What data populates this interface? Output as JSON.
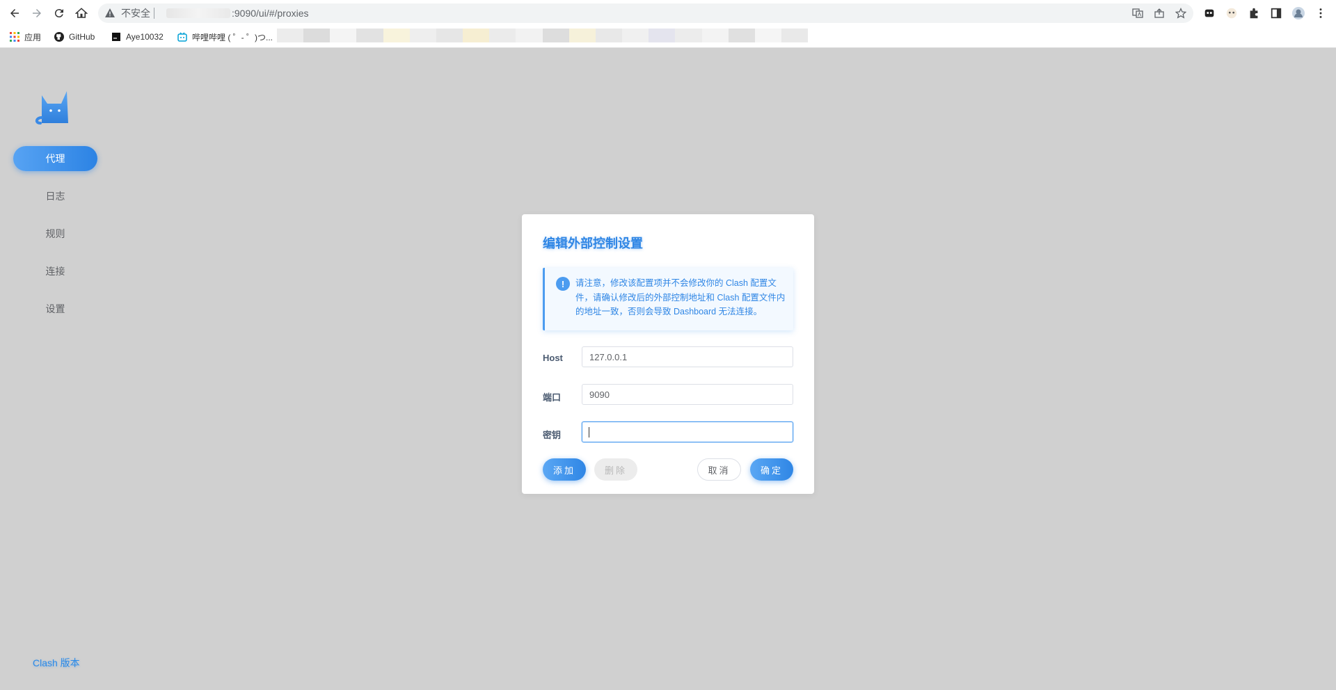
{
  "browser": {
    "security_label": "不安全",
    "url": ":9090/ui/#/proxies",
    "bookmarks": [
      {
        "label": "应用",
        "icon": "apps-grid-icon"
      },
      {
        "label": "GitHub",
        "icon": "github-icon"
      },
      {
        "label": "Aye10032",
        "icon": "page-icon"
      },
      {
        "label": "哔哩哔哩 ( ゜- ゜)つ...",
        "icon": "bilibili-icon"
      }
    ]
  },
  "sidebar": {
    "logo": "clash-cat-logo",
    "items": [
      {
        "label": "代理",
        "active": true
      },
      {
        "label": "日志",
        "active": false
      },
      {
        "label": "规则",
        "active": false
      },
      {
        "label": "连接",
        "active": false
      },
      {
        "label": "设置",
        "active": false
      }
    ],
    "version_link": "Clash 版本"
  },
  "modal": {
    "title": "编辑外部控制设置",
    "alert": "请注意，修改该配置项并不会修改你的 Clash 配置文件，请确认修改后的外部控制地址和 Clash 配置文件内的地址一致，否则会导致 Dashboard 无法连接。",
    "fields": {
      "host": {
        "label": "Host",
        "value": "127.0.0.1"
      },
      "port": {
        "label": "端口",
        "value": "9090"
      },
      "secret": {
        "label": "密钥",
        "value": ""
      }
    },
    "buttons": {
      "add": "添加",
      "delete": "删除",
      "cancel": "取消",
      "confirm": "确定"
    }
  },
  "colors": {
    "accent": "#2f86e5",
    "background": "#d0d0d0"
  }
}
